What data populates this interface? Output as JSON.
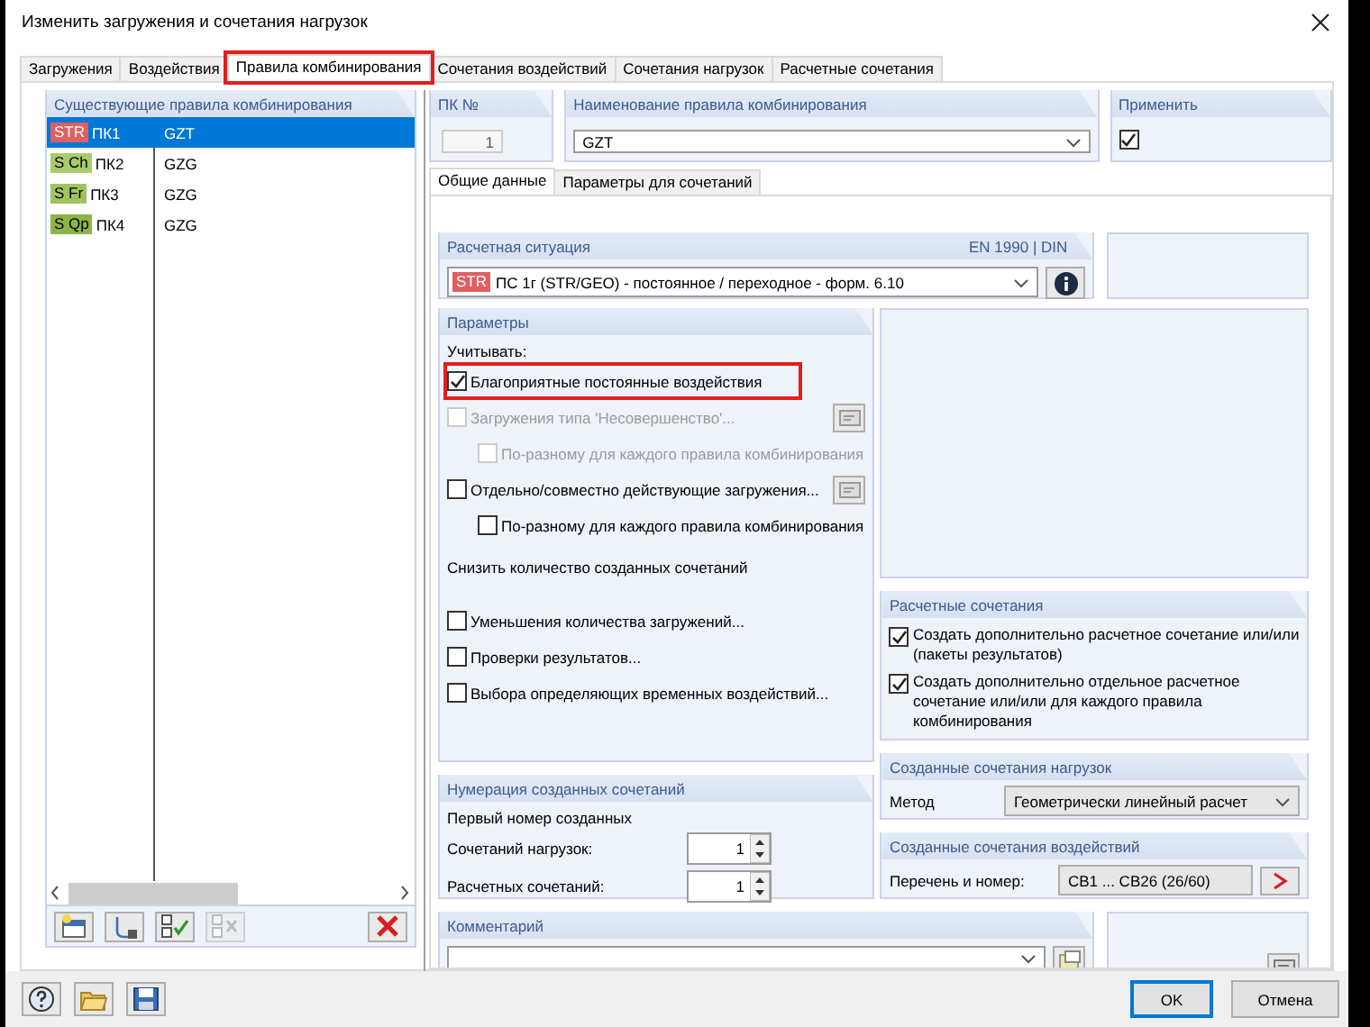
{
  "window": {
    "title": "Изменить загружения и сочетания нагрузок"
  },
  "tabs": [
    {
      "label": "Загружения",
      "selected": false,
      "highlighted": false
    },
    {
      "label": "Воздействия",
      "selected": false,
      "highlighted": false
    },
    {
      "label": "Правила комбинирования",
      "selected": true,
      "highlighted": true
    },
    {
      "label": "Сочетания воздействий",
      "selected": false,
      "highlighted": false
    },
    {
      "label": "Сочетания нагрузок",
      "selected": false,
      "highlighted": false
    },
    {
      "label": "Расчетные сочетания",
      "selected": false,
      "highlighted": false
    }
  ],
  "rules_list": {
    "title": "Существующие правила комбинирования",
    "rows": [
      {
        "tag": "STR",
        "color": "#e06060",
        "number": "ПК1",
        "name": "GZT",
        "selected": true
      },
      {
        "tag": "S Ch",
        "color": "#a9cc6b",
        "number": "ПК2",
        "name": "GZG",
        "selected": false
      },
      {
        "tag": "S Fr",
        "color": "#9ec45c",
        "number": "ПК3",
        "name": "GZG",
        "selected": false
      },
      {
        "tag": "S Qp",
        "color": "#8db545",
        "number": "ПК4",
        "name": "GZG",
        "selected": false
      }
    ]
  },
  "rule_number": {
    "title": "ПК №",
    "value": "1"
  },
  "rule_name": {
    "title": "Наименование правила комбинирования",
    "value": "GZT"
  },
  "apply": {
    "title": "Применить",
    "checked": true
  },
  "subtabs": [
    {
      "label": "Общие данные",
      "selected": true
    },
    {
      "label": "Параметры для сочетаний",
      "selected": false
    }
  ],
  "design_situation": {
    "title": "Расчетная ситуация",
    "standard": "EN 1990 | DIN",
    "tag": "STR",
    "color": "#e06060",
    "value": "ПС 1г (STR/GEO) - постоянное / переходное - форм. 6.10"
  },
  "parameters": {
    "title": "Параметры",
    "consider_label": "Учитывать:",
    "options": [
      {
        "label": "Благоприятные постоянные воздействия",
        "checked": true,
        "disabled": false,
        "highlighted": true,
        "has_button": false
      },
      {
        "label": "Загружения типа 'Несовершенство'...",
        "checked": false,
        "disabled": true,
        "highlighted": false,
        "has_button": true,
        "children": [
          {
            "label": "По-разному для каждого правила комбинирования",
            "checked": false,
            "disabled": true
          }
        ]
      },
      {
        "label": "Отдельно/совместно действующие загружения...",
        "checked": false,
        "disabled": false,
        "highlighted": false,
        "has_button": true,
        "children": [
          {
            "label": "По-разному для каждого правила комбинирования",
            "checked": false,
            "disabled": false
          }
        ]
      }
    ],
    "reduce_label": "Снизить количество созданных сочетаний",
    "reduce_options": [
      {
        "label": "Уменьшения количества загружений...",
        "checked": false
      },
      {
        "label": "Проверки результатов...",
        "checked": false
      },
      {
        "label": "Выбора определяющих временных воздействий...",
        "checked": false
      }
    ]
  },
  "numbering": {
    "title": "Нумерация созданных сочетаний",
    "subtitle": "Первый номер созданных",
    "fields": [
      {
        "label": "Сочетаний нагрузок:",
        "value": "1"
      },
      {
        "label": "Расчетных сочетаний:",
        "value": "1"
      }
    ]
  },
  "design_combinations": {
    "title": "Расчетные сочетания",
    "options": [
      {
        "label": "Создать дополнительно расчетное сочетание или/или (пакеты результатов)",
        "checked": true
      },
      {
        "label": "Создать дополнительно отдельное расчетное сочетание или/или для каждого правила комбинирования",
        "checked": true
      }
    ]
  },
  "load_combinations": {
    "title": "Созданные сочетания нагрузок",
    "method_label": "Метод",
    "method": "Геометрически линейный расчет"
  },
  "action_combinations": {
    "title": "Созданные сочетания воздействий",
    "list_label": "Перечень и номер:",
    "value": "СВ1 ... СВ26 (26/60)"
  },
  "comment": {
    "title": "Комментарий"
  },
  "buttons": [
    {
      "label": "OK",
      "default": true
    },
    {
      "label": "Отмена",
      "default": false
    }
  ]
}
